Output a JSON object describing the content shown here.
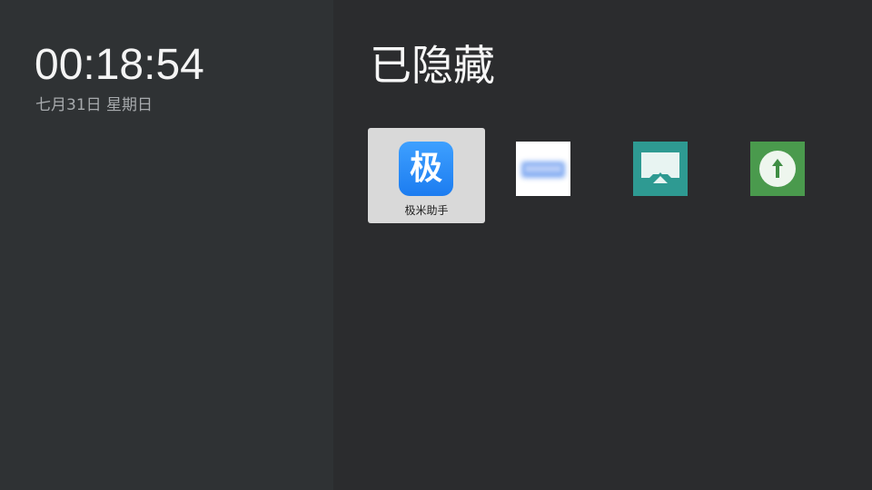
{
  "sidebar": {
    "time": "00:18:54",
    "date": "七月31日 星期日"
  },
  "main": {
    "title": "已隐藏",
    "apps": [
      {
        "label": "极米助手",
        "icon": "jimi-assistant-icon",
        "icon_text": "极",
        "focused": true
      },
      {
        "label": "",
        "icon": "blurred-app-icon",
        "focused": false
      },
      {
        "label": "",
        "icon": "screen-cast-icon",
        "focused": false
      },
      {
        "label": "",
        "icon": "upload-arrow-icon",
        "focused": false
      }
    ]
  },
  "colors": {
    "background": "#2b2c2e",
    "sidebar_background": "#2f3234",
    "focus_tile": "#d9d9d9",
    "jimi_blue": "#1c7cf0",
    "teal": "#2e9a92",
    "green": "#4a9a4d"
  }
}
